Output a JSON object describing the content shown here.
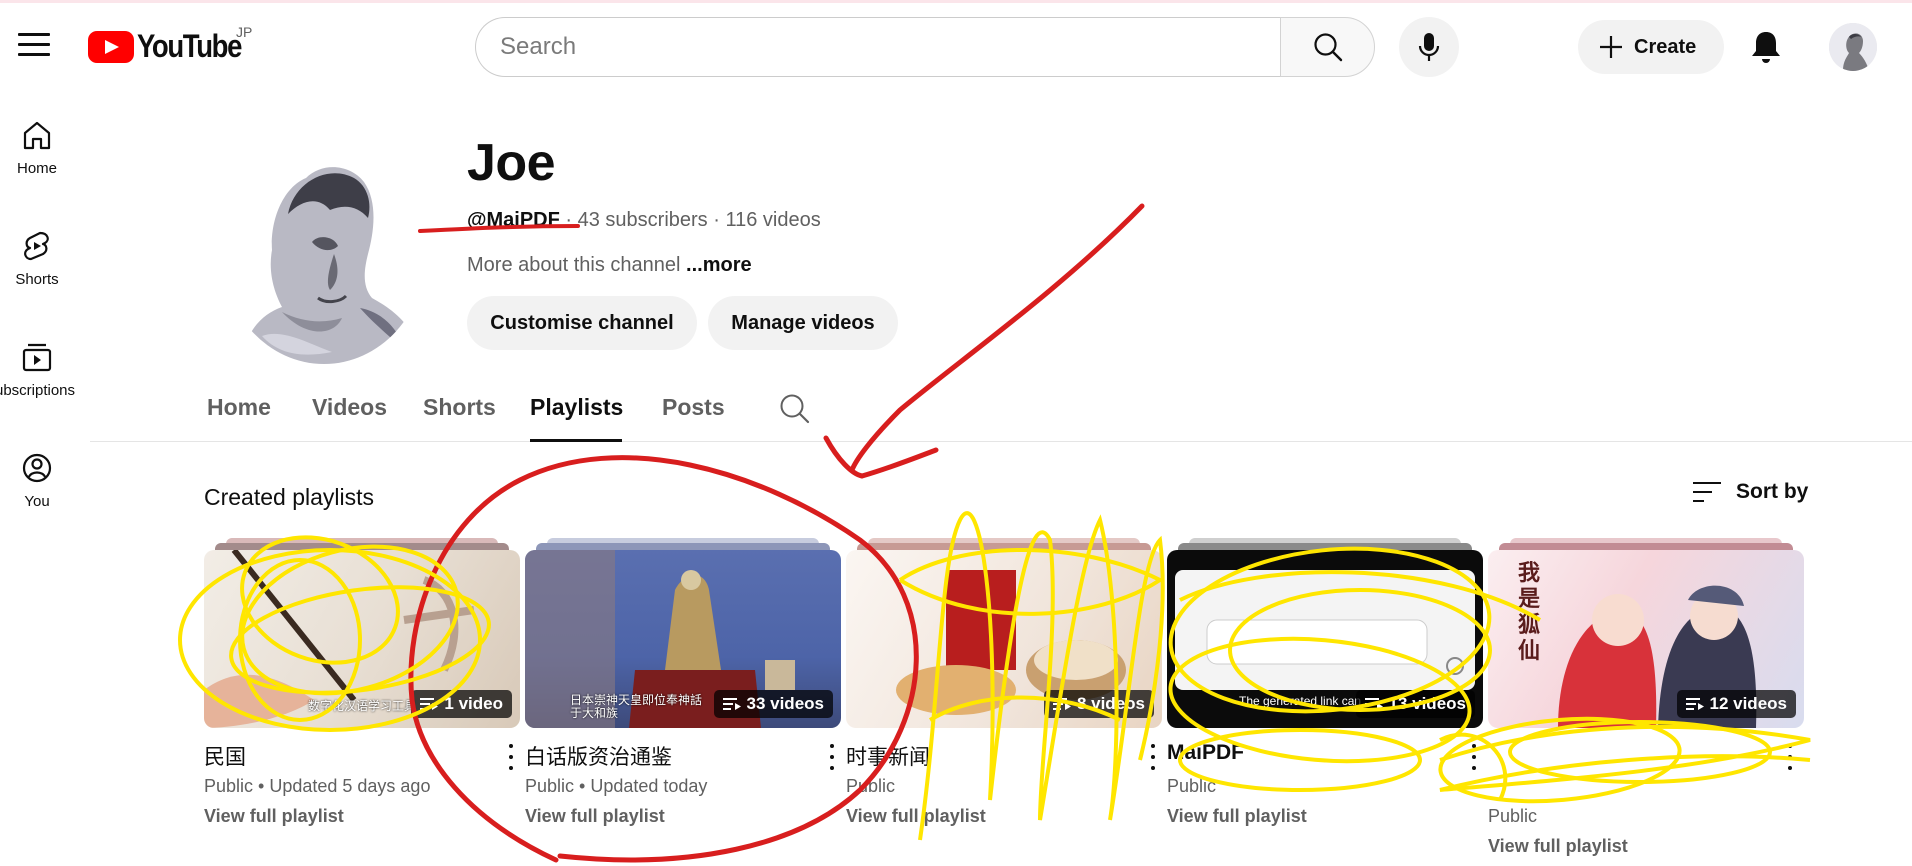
{
  "masthead": {
    "logo_text": "YouTube",
    "region": "JP",
    "search_placeholder": "Search",
    "create_label": "Create"
  },
  "sidebar": {
    "items": [
      {
        "label": "Home",
        "icon": "home-icon"
      },
      {
        "label": "Shorts",
        "icon": "shorts-icon"
      },
      {
        "label": "Subscriptions",
        "icon": "subscriptions-icon"
      },
      {
        "label": "You",
        "icon": "you-icon"
      }
    ]
  },
  "channel": {
    "name": "Joe",
    "handle": "@MaiPDF",
    "separator": " · ",
    "subscribers": "43 subscribers",
    "videos": "116 videos",
    "about": "More about this channel ",
    "more": "...more",
    "customise_label": "Customise channel",
    "manage_label": "Manage videos"
  },
  "tabs": [
    {
      "label": "Home",
      "active": false
    },
    {
      "label": "Videos",
      "active": false
    },
    {
      "label": "Shorts",
      "active": false
    },
    {
      "label": "Playlists",
      "active": true
    },
    {
      "label": "Posts",
      "active": false
    }
  ],
  "section": {
    "title": "Created playlists",
    "sort_label": "Sort by"
  },
  "playlists": [
    {
      "title": "民国",
      "count": "1 video",
      "status": "Public • Updated 5 days ago",
      "link": "View full playlist",
      "caption": "数字化汉语学习工具"
    },
    {
      "title": "白话版资治通鉴",
      "count": "33 videos",
      "status": "Public • Updated today",
      "link": "View full playlist",
      "caption": "日本崇神天皇即位奉神話于大和族"
    },
    {
      "title": "时事新闻",
      "count": "8 videos",
      "status": "Public",
      "link": "View full playlist",
      "caption": ""
    },
    {
      "title": "MaiPDF",
      "count": "13 videos",
      "status": "Public",
      "link": "View full playlist",
      "caption": "The generated link can"
    },
    {
      "title": "",
      "count": "12 videos",
      "status": "Public",
      "link": "View full playlist",
      "caption": "我是狐仙"
    }
  ],
  "colors": {
    "brand_red": "#ff0000",
    "annotation_red": "#d81e1e",
    "annotation_yellow": "#ffe600"
  }
}
